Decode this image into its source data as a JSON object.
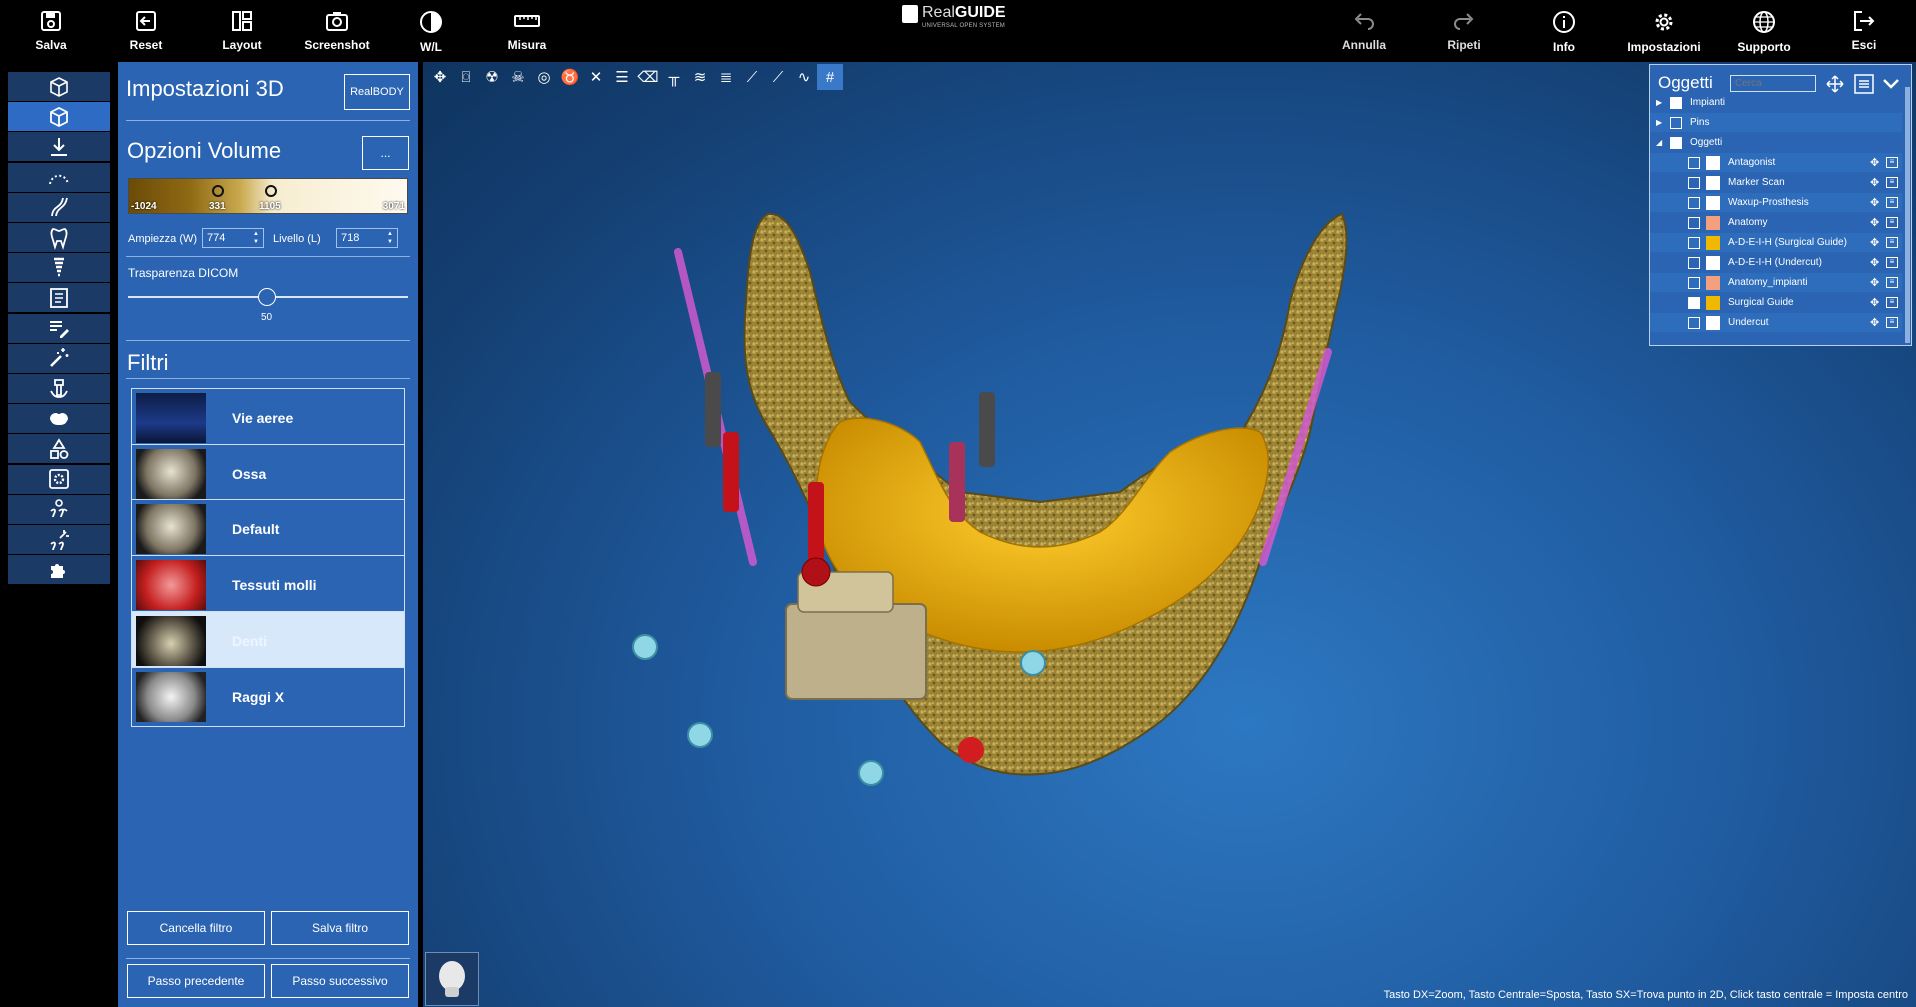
{
  "toolbar": {
    "left": [
      {
        "label": "Salva",
        "icon": "save-icon"
      },
      {
        "label": "Reset",
        "icon": "reset-icon"
      },
      {
        "label": "Layout",
        "icon": "layout-icon"
      },
      {
        "label": "Screenshot",
        "icon": "camera-icon"
      },
      {
        "label": "W/L",
        "icon": "contrast-icon"
      },
      {
        "label": "Misura",
        "icon": "ruler-icon"
      }
    ],
    "right": [
      {
        "label": "Annulla",
        "icon": "undo-icon"
      },
      {
        "label": "Ripeti",
        "icon": "redo-icon"
      },
      {
        "label": "Info",
        "icon": "info-icon"
      },
      {
        "label": "Impostazioni",
        "icon": "gear-icon"
      },
      {
        "label": "Supporto",
        "icon": "globe-icon"
      },
      {
        "label": "Esci",
        "icon": "exit-icon"
      }
    ]
  },
  "logo": {
    "brand_light": "Real",
    "brand_bold": "GUIDE",
    "tagline": "UNIVERSAL OPEN SYSTEM"
  },
  "rail": [
    "cube-outline-icon",
    "cube-3d-icon",
    "download-icon",
    "arch-curve-icon",
    "nerve-path-icon",
    "tooth-icon",
    "implant-icon",
    "report-icon",
    "edit-list-icon",
    "magic-wand-icon",
    "abutment-icon",
    "teeth-set-icon",
    "shapes-icon",
    "settings-box-icon",
    "implant-group-icon",
    "implant-wand-icon",
    "puzzle-icon"
  ],
  "panel": {
    "title": "Impostazioni 3D",
    "realbody": "RealBODY",
    "volume_title": "Opzioni Volume",
    "volume_more": "...",
    "wl_labels": [
      "-1024",
      "331",
      "1105",
      "3071"
    ],
    "ampiezza_label": "Ampiezza (W)",
    "ampiezza_value": "774",
    "livello_label": "Livello (L)",
    "livello_value": "718",
    "trasparenza_label": "Trasparenza DICOM",
    "trasparenza_value": "50",
    "trasparenza_level": 0.5,
    "filtri_title": "Filtri",
    "filters": [
      {
        "label": "Vie aeree",
        "selected": false
      },
      {
        "label": "Ossa",
        "selected": false
      },
      {
        "label": "Default",
        "selected": false
      },
      {
        "label": "Tessuti molli",
        "selected": false
      },
      {
        "label": "Denti",
        "selected": true
      },
      {
        "label": "Raggi X",
        "selected": false
      }
    ],
    "cancella_filtro": "Cancella filtro",
    "salva_filtro": "Salva filtro",
    "passo_precedente": "Passo precedente",
    "passo_successivo": "Passo successivo"
  },
  "viewport": {
    "status_text": "Tasto DX=Zoom, Tasto Centrale=Sposta, Tasto SX=Trova punto in 2D, Click tasto centrale = Imposta centro"
  },
  "objects": {
    "title": "Oggetti",
    "search_placeholder": "Cerca",
    "rows": [
      {
        "label": "Impianti",
        "level": 0,
        "expand": "▶",
        "checked": true,
        "color": null
      },
      {
        "label": "Pins",
        "level": 0,
        "expand": "▶",
        "checked": false,
        "color": null
      },
      {
        "label": "Oggetti",
        "level": 0,
        "expand": "◢",
        "checked": true,
        "color": null
      },
      {
        "label": "Antagonist",
        "level": 1,
        "checked": false,
        "color": "#ffffff"
      },
      {
        "label": "Marker Scan",
        "level": 1,
        "checked": false,
        "color": "#ffffff"
      },
      {
        "label": "Waxup-Prosthesis",
        "level": 1,
        "checked": false,
        "color": "#ffffff"
      },
      {
        "label": "Anatomy",
        "level": 1,
        "checked": false,
        "color": "#f4a07e"
      },
      {
        "label": "A-D-E-I-H (Surgical Guide)",
        "level": 1,
        "checked": false,
        "color": "#f0b800"
      },
      {
        "label": "A-D-E-I-H (Undercut)",
        "level": 1,
        "checked": false,
        "color": "#ffffff"
      },
      {
        "label": "Anatomy_impianti",
        "level": 1,
        "checked": false,
        "color": "#f4a07e"
      },
      {
        "label": "Surgical Guide",
        "level": 1,
        "checked": true,
        "color": "#f0b800"
      },
      {
        "label": "Undercut",
        "level": 1,
        "checked": false,
        "color": "#ffffff"
      }
    ]
  },
  "colors": {
    "panel": "#2a64b2",
    "rail": "#1b3a66",
    "rail_active": "#2e6bc4",
    "bone": "#b59b4a",
    "guide": "#e8b10a"
  }
}
